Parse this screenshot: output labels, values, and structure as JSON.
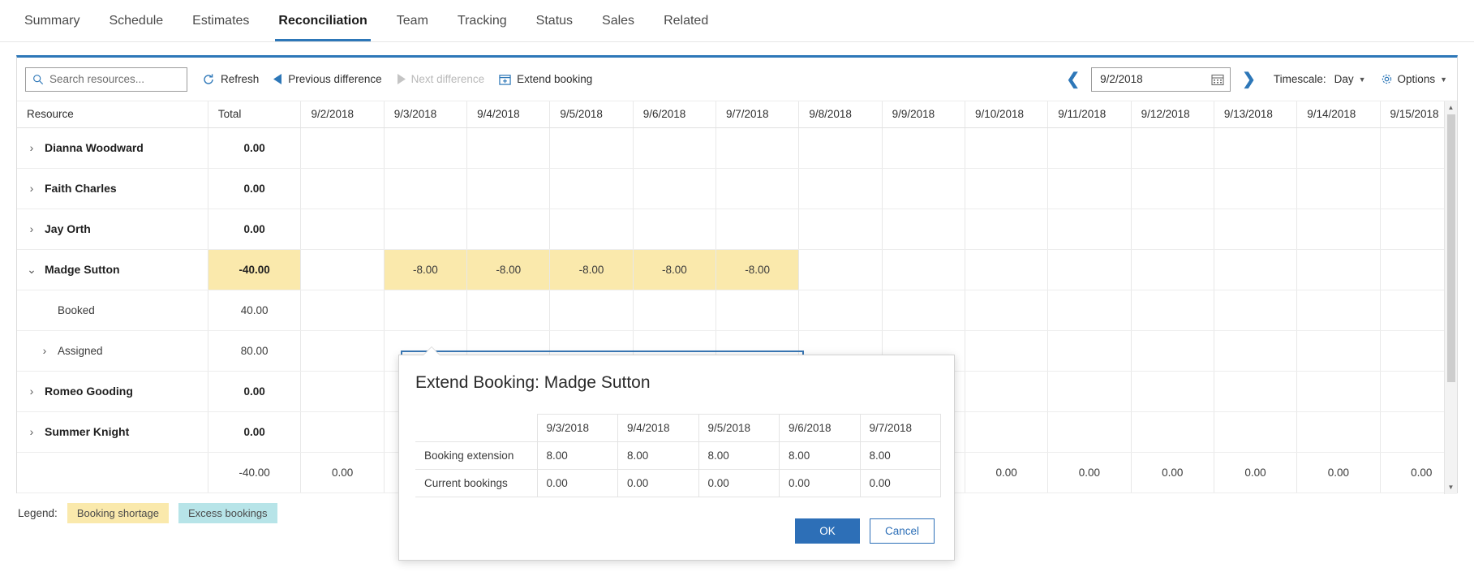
{
  "tabs": [
    {
      "label": "Summary",
      "active": false
    },
    {
      "label": "Schedule",
      "active": false
    },
    {
      "label": "Estimates",
      "active": false
    },
    {
      "label": "Reconciliation",
      "active": true
    },
    {
      "label": "Team",
      "active": false
    },
    {
      "label": "Tracking",
      "active": false
    },
    {
      "label": "Status",
      "active": false
    },
    {
      "label": "Sales",
      "active": false
    },
    {
      "label": "Related",
      "active": false
    }
  ],
  "toolbar": {
    "search_placeholder": "Search resources...",
    "search_value": "",
    "refresh_label": "Refresh",
    "previous_difference_label": "Previous difference",
    "next_difference_label": "Next difference",
    "extend_booking_label": "Extend booking",
    "date_value": "9/2/2018",
    "timescale_label": "Timescale:",
    "timescale_value": "Day",
    "options_label": "Options"
  },
  "grid": {
    "columns": [
      "Resource",
      "Total",
      "9/2/2018",
      "9/3/2018",
      "9/4/2018",
      "9/5/2018",
      "9/6/2018",
      "9/7/2018",
      "9/8/2018",
      "9/9/2018",
      "9/10/2018",
      "9/11/2018",
      "9/12/2018",
      "9/13/2018",
      "9/14/2018",
      "9/15/2018"
    ],
    "rows": [
      {
        "name": "Dianna Woodward",
        "level": 0,
        "expanded": false,
        "total": "0.00",
        "total_highlight": false,
        "cells": [
          "",
          "",
          "",
          "",
          "",
          "",
          "",
          "",
          "",
          "",
          "",
          "",
          "",
          ""
        ]
      },
      {
        "name": "Faith Charles",
        "level": 0,
        "expanded": false,
        "total": "0.00",
        "total_highlight": false,
        "cells": [
          "",
          "",
          "",
          "",
          "",
          "",
          "",
          "",
          "",
          "",
          "",
          "",
          "",
          ""
        ]
      },
      {
        "name": "Jay Orth",
        "level": 0,
        "expanded": false,
        "total": "0.00",
        "total_highlight": false,
        "cells": [
          "",
          "",
          "",
          "",
          "",
          "",
          "",
          "",
          "",
          "",
          "",
          "",
          "",
          ""
        ]
      },
      {
        "name": "Madge Sutton",
        "level": 0,
        "expanded": true,
        "total": "-40.00",
        "total_highlight": true,
        "cells": [
          "",
          "-8.00",
          "-8.00",
          "-8.00",
          "-8.00",
          "-8.00",
          "",
          "",
          "",
          "",
          "",
          "",
          "",
          ""
        ]
      },
      {
        "name": "Booked",
        "level": 1,
        "expanded": null,
        "total": "40.00",
        "total_highlight": false,
        "cells": [
          "",
          "",
          "",
          "",
          "",
          "",
          "",
          "",
          "",
          "",
          "",
          "",
          "",
          ""
        ]
      },
      {
        "name": "Assigned",
        "level": 1,
        "expanded": false,
        "total": "80.00",
        "total_highlight": false,
        "cells": [
          "",
          "",
          "",
          "",
          "",
          "",
          "",
          "",
          "",
          "",
          "",
          "",
          "",
          ""
        ]
      },
      {
        "name": "Romeo Gooding",
        "level": 0,
        "expanded": false,
        "total": "0.00",
        "total_highlight": false,
        "cells": [
          "",
          "",
          "",
          "",
          "",
          "",
          "",
          "",
          "",
          "",
          "",
          "",
          "",
          ""
        ]
      },
      {
        "name": "Summer Knight",
        "level": 0,
        "expanded": false,
        "total": "0.00",
        "total_highlight": false,
        "cells": [
          "",
          "",
          "",
          "",
          "",
          "",
          "",
          "",
          "",
          "",
          "",
          "",
          "",
          ""
        ]
      }
    ],
    "footer": {
      "name": "",
      "total": "-40.00",
      "cells": [
        "0.00",
        "",
        "",
        "",
        "",
        "",
        "",
        "",
        "0.00",
        "0.00",
        "0.00",
        "0.00",
        "0.00",
        "0.00"
      ]
    }
  },
  "legend": {
    "label": "Legend:",
    "shortage": "Booking shortage",
    "excess": "Excess bookings"
  },
  "dialog": {
    "title": "Extend Booking: Madge Sutton",
    "columns": [
      "",
      "9/3/2018",
      "9/4/2018",
      "9/5/2018",
      "9/6/2018",
      "9/7/2018"
    ],
    "rows": [
      {
        "label": "Booking extension",
        "values": [
          "8.00",
          "8.00",
          "8.00",
          "8.00",
          "8.00"
        ]
      },
      {
        "label": "Current bookings",
        "values": [
          "0.00",
          "0.00",
          "0.00",
          "0.00",
          "0.00"
        ]
      }
    ],
    "ok_label": "OK",
    "cancel_label": "Cancel"
  },
  "colors": {
    "accent": "#2d77b8",
    "shortage": "#fae9ac",
    "excess": "#b7e4e8",
    "selection": "#3a78b5"
  }
}
